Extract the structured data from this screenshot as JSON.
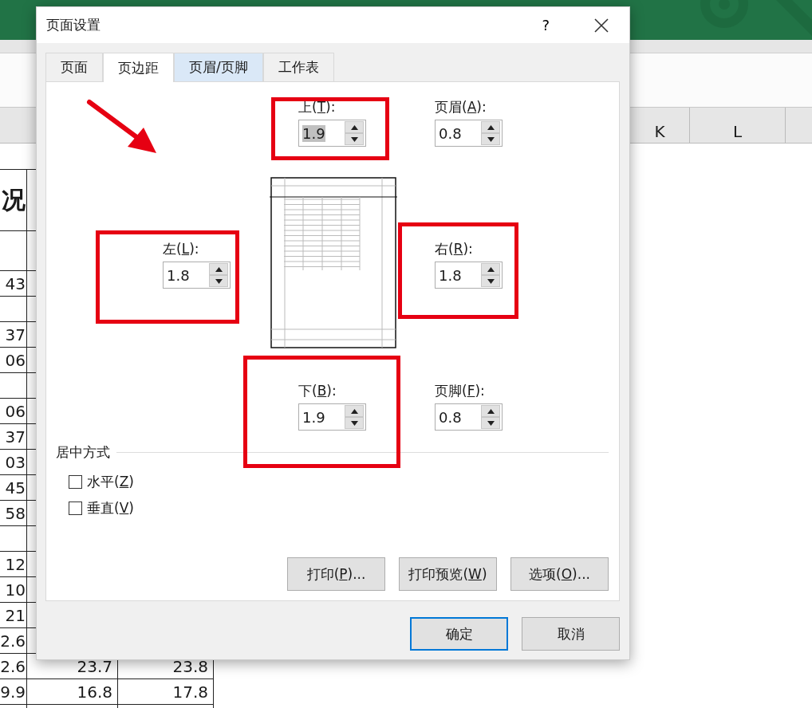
{
  "sheet": {
    "column_headers": [
      "K",
      "L"
    ],
    "rows": [
      {
        "kind": "title",
        "cells": [
          "况"
        ]
      },
      {
        "kind": "tall"
      },
      {
        "kind": "data",
        "cells": [
          "43"
        ]
      },
      {
        "kind": "data"
      },
      {
        "kind": "data",
        "cells": [
          "37"
        ]
      },
      {
        "kind": "data",
        "cells": [
          "06"
        ]
      },
      {
        "kind": "data"
      },
      {
        "kind": "data",
        "cells": [
          "06"
        ]
      },
      {
        "kind": "data",
        "cells": [
          "37"
        ]
      },
      {
        "kind": "data",
        "cells": [
          "03"
        ]
      },
      {
        "kind": "data",
        "cells": [
          "45"
        ]
      },
      {
        "kind": "data",
        "cells": [
          "58"
        ]
      },
      {
        "kind": "data"
      },
      {
        "kind": "data",
        "cells": [
          "12"
        ]
      },
      {
        "kind": "data",
        "cells": [
          "10"
        ]
      },
      {
        "kind": "data",
        "cells": [
          "21"
        ]
      },
      {
        "kind": "data",
        "cells": [
          "2.6"
        ]
      },
      {
        "kind": "data",
        "cells": [
          "2.6",
          "23.7",
          "23.8"
        ]
      },
      {
        "kind": "data",
        "cells": [
          "9.9",
          "16.8",
          "17.8"
        ]
      },
      {
        "kind": "data"
      }
    ]
  },
  "dialog": {
    "title": "页面设置",
    "help": "?",
    "tabs": [
      {
        "label": "页面",
        "selected": false,
        "hovered": false
      },
      {
        "label": "页边距",
        "selected": true,
        "hovered": false
      },
      {
        "label": "页眉/页脚",
        "selected": false,
        "hovered": true
      },
      {
        "label": "工作表",
        "selected": false,
        "hovered": false
      }
    ],
    "margins": [
      {
        "kind": "top",
        "label": [
          "上(",
          "T",
          "):"
        ],
        "value": "1.9",
        "text_highlighted": true
      },
      {
        "kind": "header",
        "label": [
          "页眉(",
          "A",
          "):"
        ],
        "value": "0.8",
        "text_highlighted": false
      },
      {
        "kind": "left",
        "label": [
          "左(",
          "L",
          "):"
        ],
        "value": "1.8",
        "text_highlighted": false
      },
      {
        "kind": "right",
        "label": [
          "右(",
          "R",
          "):"
        ],
        "value": "1.8",
        "text_highlighted": false
      },
      {
        "kind": "bottom",
        "label": [
          "下(",
          "B",
          "):"
        ],
        "value": "1.9",
        "text_highlighted": false
      },
      {
        "kind": "footer",
        "label": [
          "页脚(",
          "F",
          "):"
        ],
        "value": "0.8",
        "text_highlighted": false
      }
    ],
    "centering": {
      "title": "居中方式",
      "options": [
        {
          "label": [
            "水平(",
            "Z",
            ")"
          ],
          "checked": false
        },
        {
          "label": [
            "垂直(",
            "V",
            ")"
          ],
          "checked": false
        }
      ]
    },
    "panel_buttons": [
      {
        "label": [
          "打印(",
          "P",
          ")..."
        ]
      },
      {
        "label": [
          "打印预览(",
          "W",
          ")"
        ]
      },
      {
        "label": [
          "选项(",
          "O",
          ")..."
        ]
      }
    ],
    "buttons": [
      {
        "label": "确定",
        "default": true
      },
      {
        "label": "取消",
        "default": false
      }
    ]
  }
}
